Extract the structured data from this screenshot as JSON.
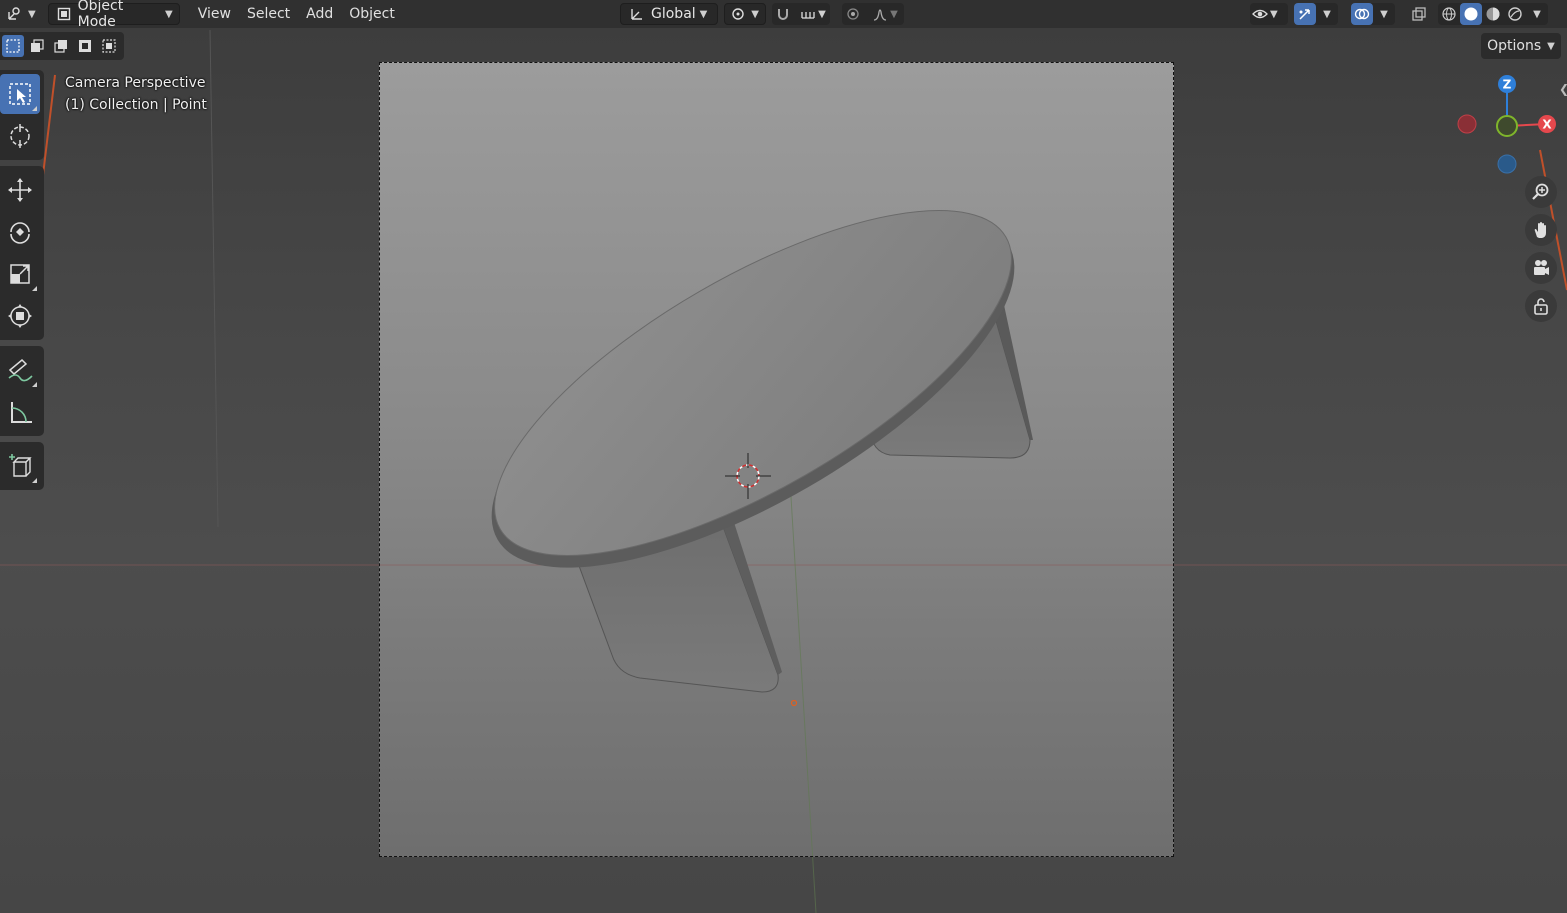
{
  "header": {
    "editor_type_icon": "3d-viewport-icon",
    "mode_label": "Object Mode",
    "menus": [
      "View",
      "Select",
      "Add",
      "Object"
    ],
    "transform_orientation": "Global"
  },
  "options": {
    "label": "Options"
  },
  "overlay": {
    "line1": "Camera Perspective",
    "line2": "(1) Collection | Point"
  },
  "gizmo": {
    "z_label": "Z",
    "x_label": "X",
    "colors": {
      "x": "#e5484d",
      "y": "#7fb52b",
      "z": "#2e7fd9"
    }
  },
  "toolbar": {
    "tools": [
      "select-box",
      "cursor",
      "move",
      "rotate",
      "scale",
      "transform",
      "annotate",
      "measure",
      "add-cube"
    ],
    "active_tool": "select-box"
  },
  "shading": {
    "active": "solid",
    "modes": [
      "wireframe",
      "solid",
      "material-preview",
      "rendered"
    ]
  },
  "colors": {
    "accent": "#4772b3",
    "header_bg": "#303030",
    "viewport_bg": "#474747"
  }
}
